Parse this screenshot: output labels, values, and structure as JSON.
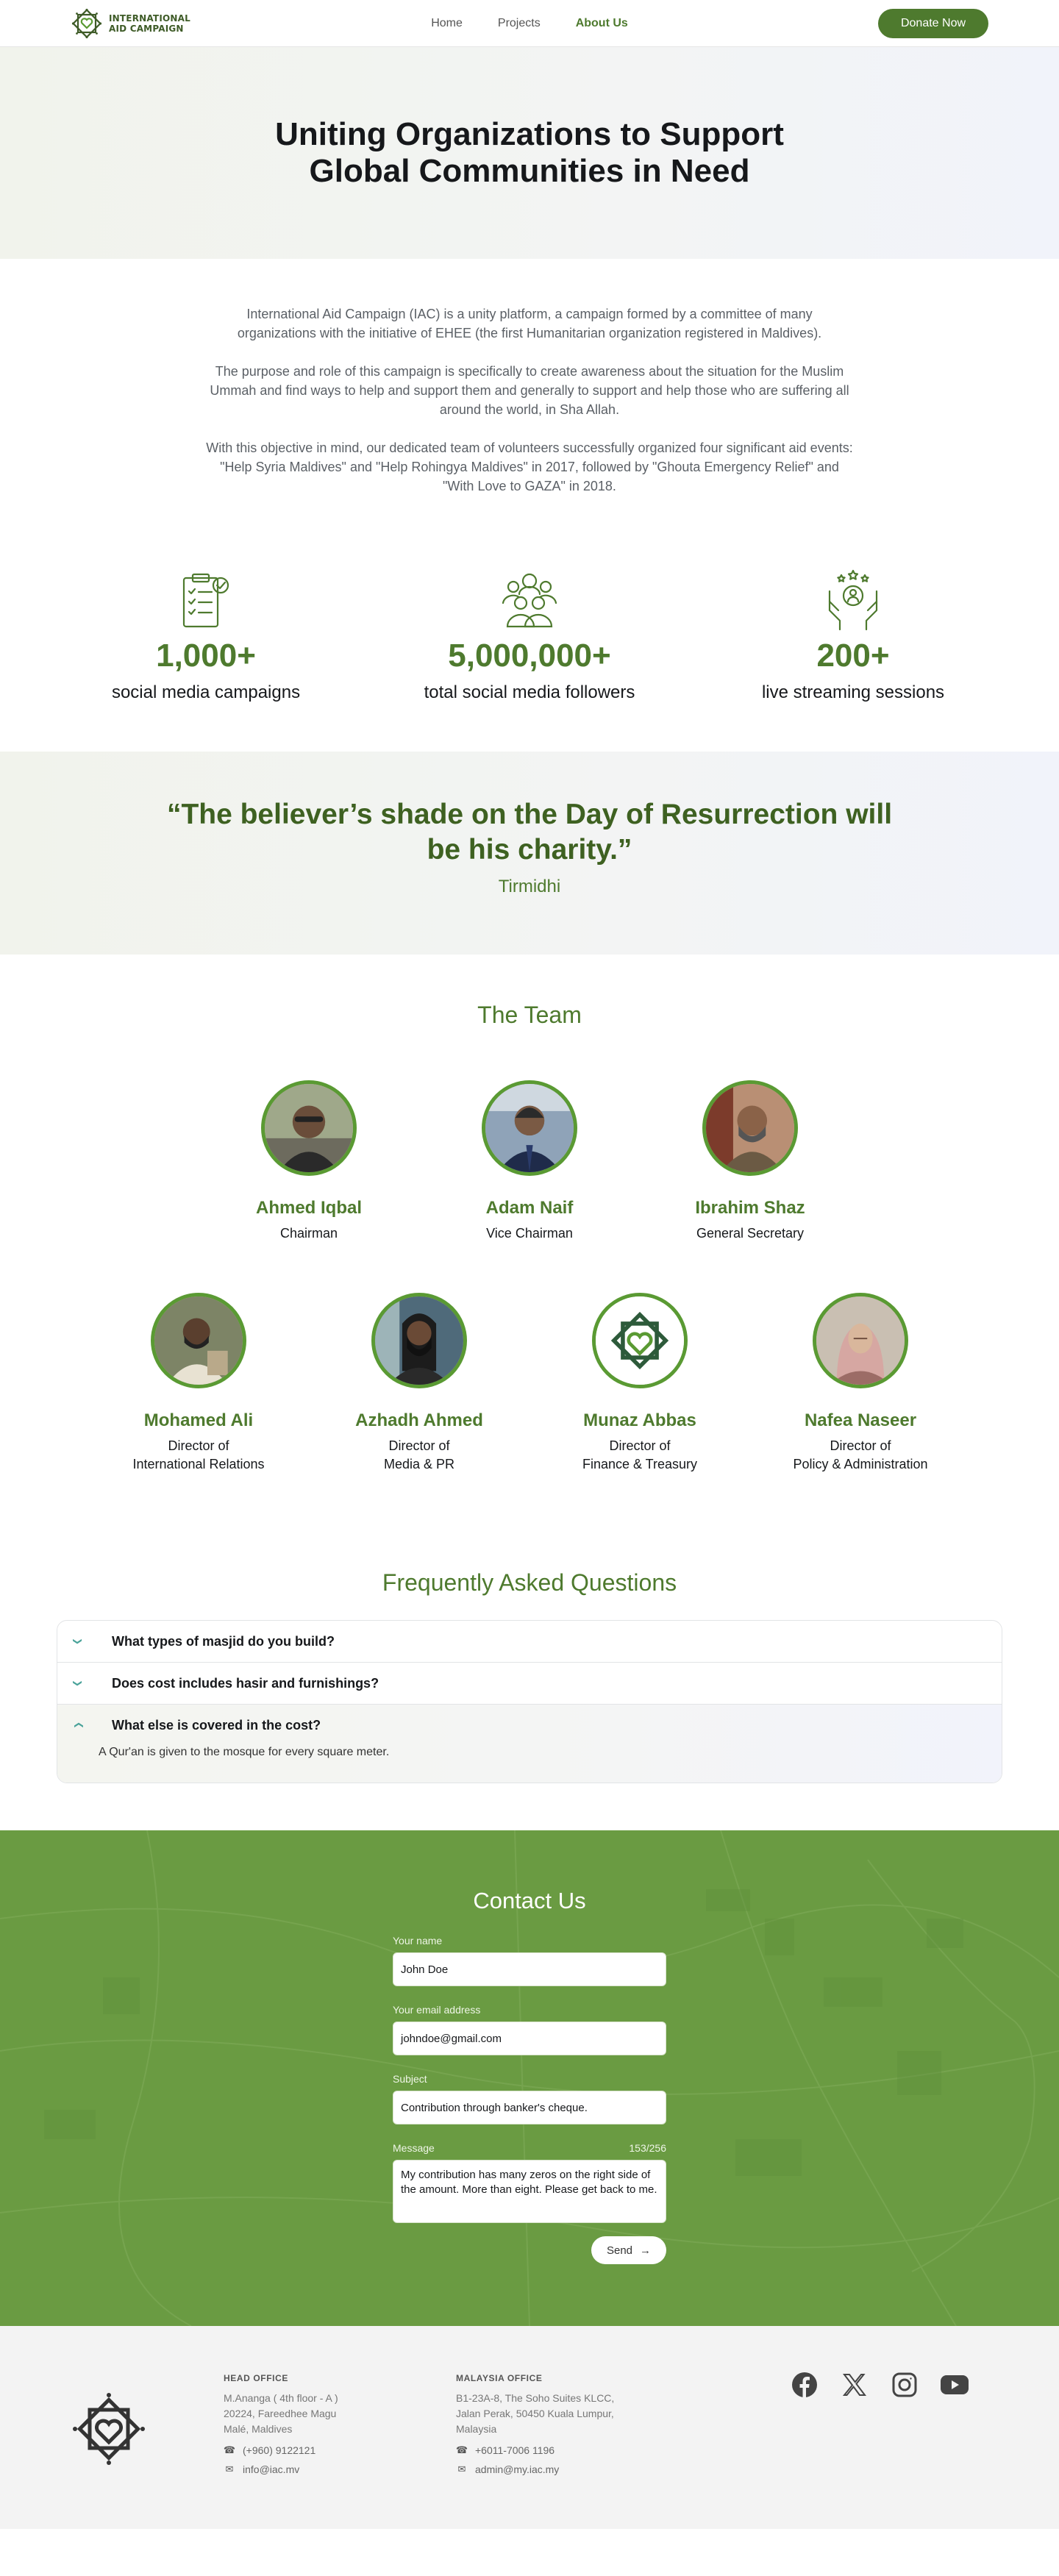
{
  "brand": {
    "name_line1": "INTERNATIONAL",
    "name_line2": "AID CAMPAIGN"
  },
  "nav": {
    "links": [
      {
        "label": "Home",
        "active": false
      },
      {
        "label": "Projects",
        "active": false
      },
      {
        "label": "About Us",
        "active": true
      }
    ],
    "donate_label": "Donate Now"
  },
  "hero": {
    "title": "Uniting Organizations to Support Global Communities in Need"
  },
  "intro": {
    "paragraphs": [
      "International Aid Campaign (IAC) is a unity platform, a campaign formed by a committee of many organizations with the initiative of EHEE (the first Humanitarian organization registered in Maldives).",
      "The purpose and role of this campaign is specifically to create awareness about the situation for the Muslim Ummah and find ways to help and support them and generally to support and help those who are suffering all around the world, in Sha Allah.",
      "With this objective in mind, our dedicated team of volunteers successfully organized four significant aid events: \"Help Syria Maldives\" and \"Help Rohingya Maldives\" in 2017, followed by \"Ghouta Emergency Relief\" and \"With Love to GAZA\" in 2018."
    ]
  },
  "stats": [
    {
      "icon": "clipboard-check-icon",
      "value": "1,000+",
      "label": "social media campaigns"
    },
    {
      "icon": "people-group-icon",
      "value": "5,000,000+",
      "label": "total social media followers"
    },
    {
      "icon": "hands-stars-icon",
      "value": "200+",
      "label": "live streaming sessions"
    }
  ],
  "quote": {
    "text": "“The believer’s shade on the Day of Resurrection will be his charity.”",
    "source": "Tirmidhi"
  },
  "team": {
    "title": "The Team",
    "row1": [
      {
        "name": "Ahmed Iqbal",
        "role": "Chairman"
      },
      {
        "name": "Adam Naif",
        "role": "Vice Chairman"
      },
      {
        "name": "Ibrahim Shaz",
        "role": "General Secretary"
      }
    ],
    "row2": [
      {
        "name": "Mohamed Ali",
        "role": "Director of\nInternational Relations"
      },
      {
        "name": "Azhadh Ahmed",
        "role": "Director of\nMedia & PR"
      },
      {
        "name": "Munaz Abbas",
        "role": "Director of\nFinance & Treasury"
      },
      {
        "name": "Nafea Naseer",
        "role": "Director of\nPolicy & Administration"
      }
    ]
  },
  "faq": {
    "title": "Frequently Asked Questions",
    "items": [
      {
        "question": "What types of masjid do you build?",
        "open": false
      },
      {
        "question": "Does cost includes hasir and furnishings?",
        "open": false
      },
      {
        "question": "What else is covered in the cost?",
        "open": true,
        "answer": "A Qur'an is given to the mosque for every square meter."
      }
    ]
  },
  "contact": {
    "title": "Contact Us",
    "name_label": "Your name",
    "name_value": "John Doe",
    "email_label": "Your email address",
    "email_value": "johndoe@gmail.com",
    "subject_label": "Subject",
    "subject_value": "Contribution through banker's cheque.",
    "message_label": "Message",
    "message_count": "153/256",
    "message_value": "My contribution has many zeros on the right side of the amount. More than eight. Please get back to me.",
    "send_label": "Send"
  },
  "footer": {
    "head_office": {
      "title": "HEAD OFFICE",
      "address": "M.Ananga ( 4th floor - A )\n20224, Fareedhee Magu\nMalé, Maldives",
      "phone": "(+960) 9122121",
      "email": "info@iac.mv"
    },
    "malaysia_office": {
      "title": "MALAYSIA OFFICE",
      "address": "B1-23A-8, The Soho Suites KLCC,\nJalan Perak, 50450 Kuala Lumpur,\nMalaysia",
      "phone": "+6011-7006 1196",
      "email": "admin@my.iac.my"
    },
    "socials": [
      "facebook-icon",
      "x-icon",
      "instagram-icon",
      "youtube-icon"
    ]
  },
  "colors": {
    "brand_green": "#4e7a2e",
    "accent_green": "#5a9a33",
    "contact_bg": "#6d9d45"
  }
}
